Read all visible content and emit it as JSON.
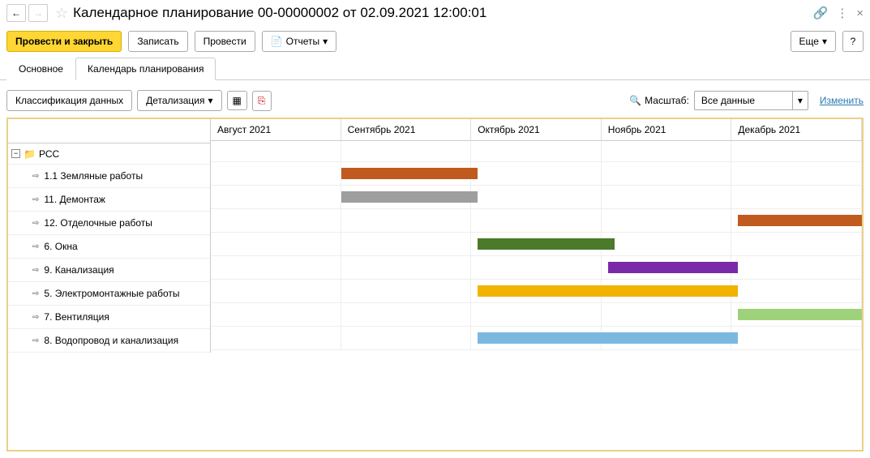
{
  "header": {
    "title": "Календарное планирование 00-00000002 от 02.09.2021 12:00:01"
  },
  "toolbar": {
    "post_close": "Провести и закрыть",
    "save": "Записать",
    "post": "Провести",
    "reports": "Отчеты",
    "more": "Еще"
  },
  "tabs": {
    "main": "Основное",
    "calendar": "Календарь планирования"
  },
  "sub_toolbar": {
    "classification": "Классификация данных",
    "detail": "Детализация",
    "scale_label": "Масштаб:",
    "scale_value": "Все данные",
    "edit_link": "Изменить"
  },
  "chart_data": {
    "type": "bar",
    "title": "",
    "months": [
      "Август 2021",
      "Сентябрь 2021",
      "Октябрь 2021",
      "Ноябрь 2021",
      "Декабрь 2021"
    ],
    "group": "РСС",
    "tasks": [
      {
        "name": "1.1 Земляные работы",
        "start_pct": 20,
        "width_pct": 21,
        "color": "#c05a1e"
      },
      {
        "name": "11. Демонтаж",
        "start_pct": 20,
        "width_pct": 21,
        "color": "#9e9e9e"
      },
      {
        "name": "12. Отделочные работы",
        "start_pct": 81,
        "width_pct": 19,
        "color": "#c05a1e"
      },
      {
        "name": "6. Окна",
        "start_pct": 41,
        "width_pct": 21,
        "color": "#4a7a2a"
      },
      {
        "name": "9. Канализация",
        "start_pct": 61,
        "width_pct": 20,
        "color": "#7a2aa8"
      },
      {
        "name": "5. Электромонтажные работы",
        "start_pct": 41,
        "width_pct": 40,
        "color": "#f2b300"
      },
      {
        "name": "7. Вентиляция",
        "start_pct": 81,
        "width_pct": 19,
        "color": "#9ed27a"
      },
      {
        "name": "8. Водопровод и канализация",
        "start_pct": 41,
        "width_pct": 40,
        "color": "#7ab8e0"
      }
    ]
  }
}
